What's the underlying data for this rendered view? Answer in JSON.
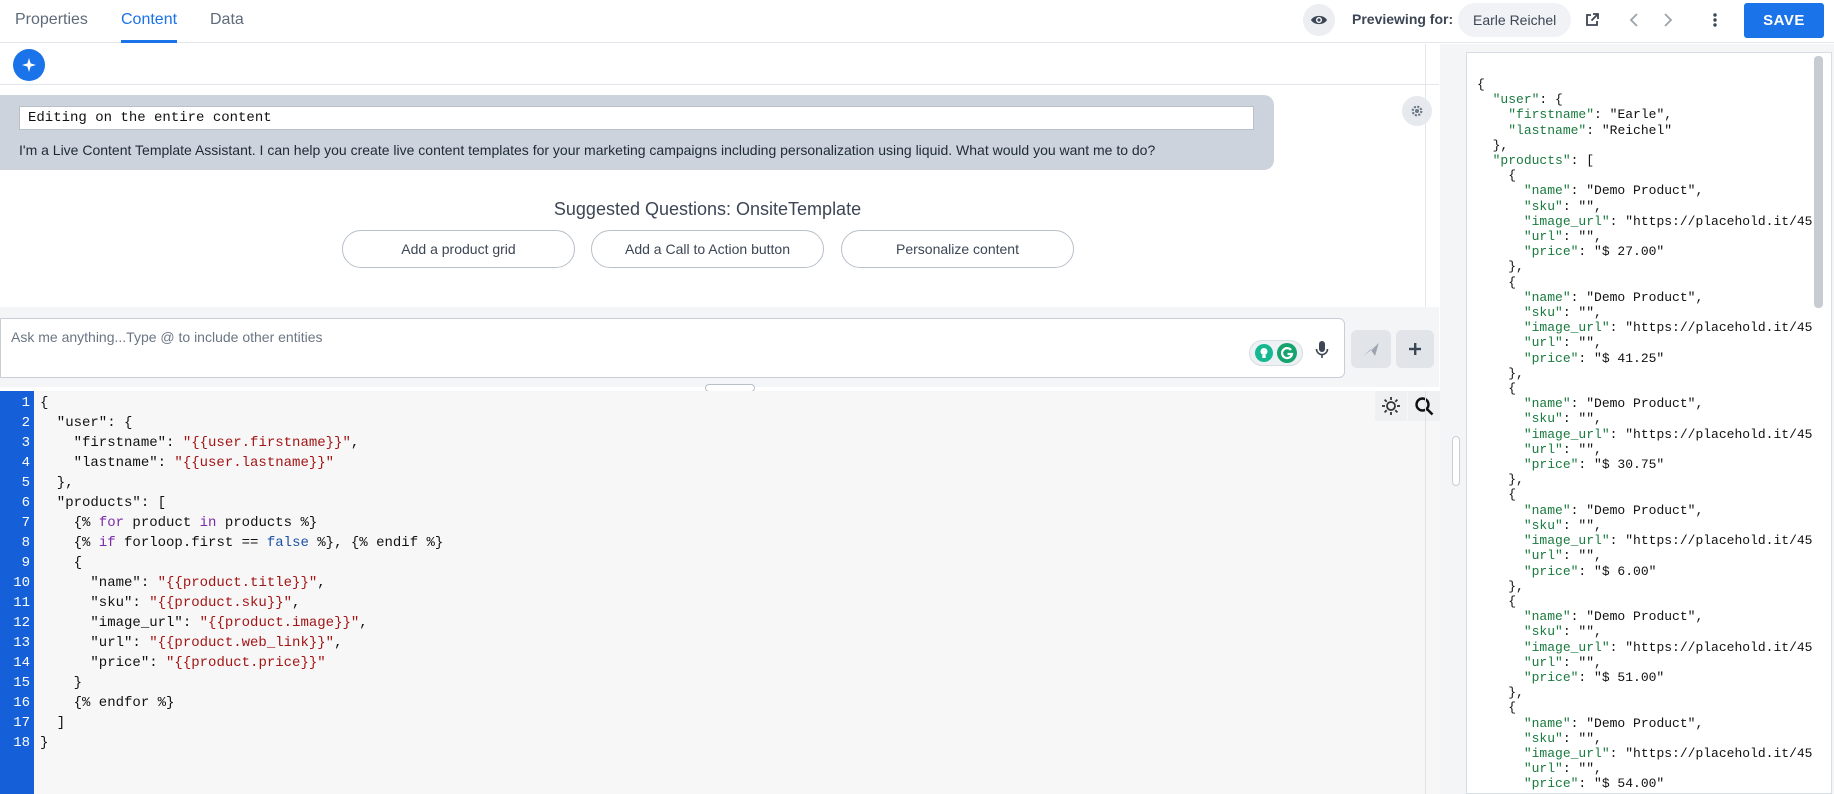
{
  "tabs": [
    {
      "label": "Properties"
    },
    {
      "label": "Content"
    },
    {
      "label": "Data"
    }
  ],
  "active_tab": "Content",
  "preview": {
    "label": "Previewing for:",
    "user_name": "Earle Reichel"
  },
  "toolbar": {
    "save_label": "SAVE"
  },
  "assistant": {
    "editing_scope": "Editing on the entire content",
    "message": "I'm a Live Content Template Assistant. I can help you create live content templates for your marketing campaigns including personalization using liquid. What would you want me to do?",
    "suggested_title": "Suggested Questions: OnsiteTemplate",
    "suggestions": [
      "Add a product grid",
      "Add a Call to Action button",
      "Personalize content"
    ],
    "input_placeholder": "Ask me anything...Type @ to include other entities"
  },
  "editor": {
    "lines": [
      "{",
      "  \"user\": {",
      "    \"firstname\": \"{{user.firstname}}\",",
      "    \"lastname\": \"{{user.lastname}}\"",
      "  },",
      "  \"products\": [",
      "    {% for product in products %}",
      "    {% if forloop.first == false %}, {% endif %}",
      "    {",
      "      \"name\": \"{{product.title}}\",",
      "      \"sku\": \"{{product.sku}}\",",
      "      \"image_url\": \"{{product.image}}\",",
      "      \"url\": \"{{product.web_link}}\",",
      "      \"price\": \"{{product.price}}\"",
      "    }",
      "    {% endfor %}",
      "  ]",
      "}"
    ]
  },
  "preview_output": {
    "user": {
      "firstname": "Earle",
      "lastname": "Reichel"
    },
    "product_name": "Demo Product",
    "image_url_prefix": "https://placehold.it/45",
    "prices": [
      "$ 27.00",
      "$ 41.25",
      "$ 30.75",
      "$ 6.00",
      "$ 51.00",
      "$ 54.00"
    ]
  },
  "colors": {
    "accent": "#1a73e8",
    "gutter": "#1560d8",
    "bubble": "#ccd3dc",
    "string": "#a31515",
    "keyword": "#7b2aa8",
    "json_key": "#197a3e"
  },
  "icons": {
    "eye": "eye-icon",
    "external": "external-link-icon",
    "prev": "chevron-left-icon",
    "next": "chevron-right-icon",
    "more": "more-vertical-icon",
    "sparkle": "sparkle-icon",
    "settings": "gear-icon",
    "mic": "microphone-icon",
    "send": "send-icon",
    "plus": "plus-icon",
    "theme": "sun-icon",
    "search": "search-icon"
  }
}
